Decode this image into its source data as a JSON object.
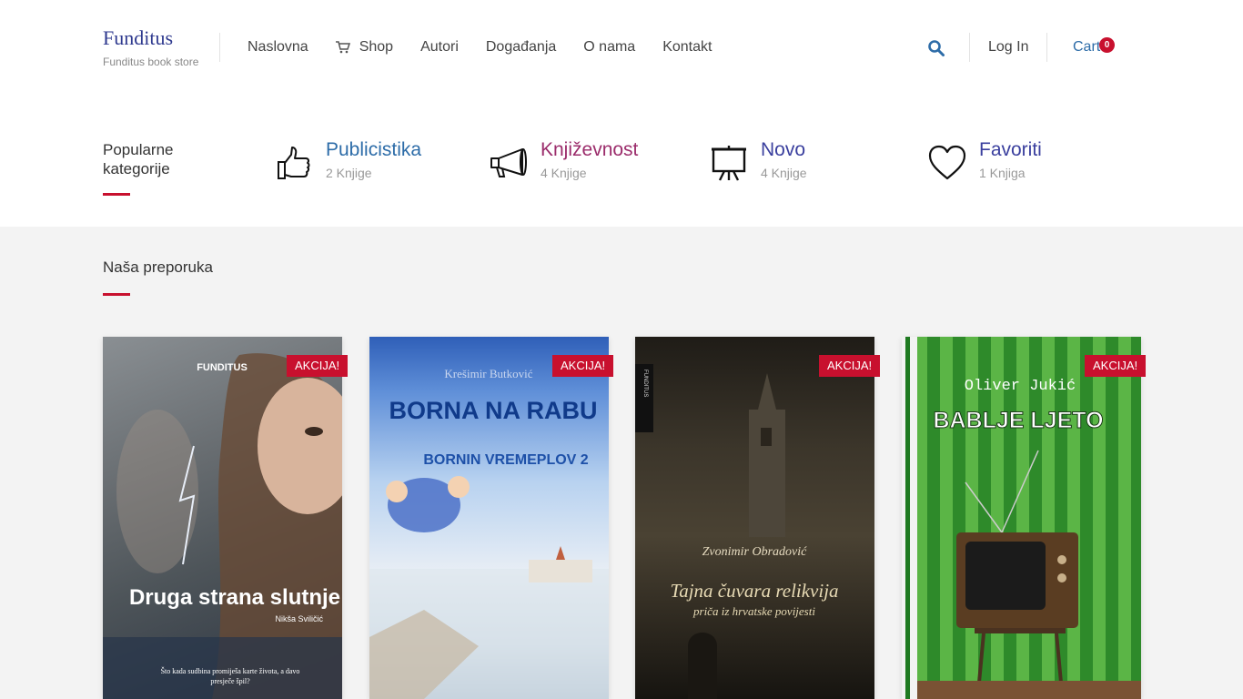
{
  "brand": {
    "name": "Funditus",
    "tagline": "Funditus book store"
  },
  "nav": {
    "items": [
      {
        "label": "Naslovna"
      },
      {
        "label": "Shop"
      },
      {
        "label": "Autori"
      },
      {
        "label": "Događanja"
      },
      {
        "label": "O nama"
      },
      {
        "label": "Kontakt"
      }
    ]
  },
  "header": {
    "login_label": "Log In",
    "cart_label": "Cart",
    "cart_count": "0"
  },
  "categories": {
    "heading": "Popularne kategorije",
    "items": [
      {
        "title": "Publicistika",
        "count": "2 Knjige",
        "color": "#2d6ca8",
        "icon": "thumbs-up-icon"
      },
      {
        "title": "Književnost",
        "count": "4 Knjige",
        "color": "#9b2c6b",
        "icon": "megaphone-icon"
      },
      {
        "title": "Novo",
        "count": "4 Knjige",
        "color": "#3a3f9e",
        "icon": "easel-icon"
      },
      {
        "title": "Favoriti",
        "count": "1 Knjiga",
        "color": "#3a3f9e",
        "icon": "heart-icon"
      }
    ]
  },
  "recommended": {
    "heading": "Naša preporuka",
    "books": [
      {
        "badge": "AKCIJA!",
        "publisher": "FUNDITUS",
        "cover_title": "Druga strana slutnje",
        "author": "Nikša Sviličić",
        "blurb": "Što kada sudbina promiješa karte života, a davo presječe špil?"
      },
      {
        "badge": "AKCIJA!",
        "author": "Krešimir Butković",
        "cover_title": "BORNA NA RABU",
        "subtitle": "BORNIN VREMEPLOV 2"
      },
      {
        "badge": "AKCIJA!",
        "publisher": "FUNDITUS",
        "author": "Zvonimir Obradović",
        "cover_title": "Tajna čuvara relikvija",
        "subtitle": "priča iz hrvatske povijesti"
      },
      {
        "badge": "AKCIJA!",
        "author": "Oliver Jukić",
        "cover_title": "BABLJE LJETO"
      }
    ]
  },
  "colors": {
    "accent": "#c8102e",
    "link": "#2d6ca8",
    "brand": "#2f3a8f"
  }
}
